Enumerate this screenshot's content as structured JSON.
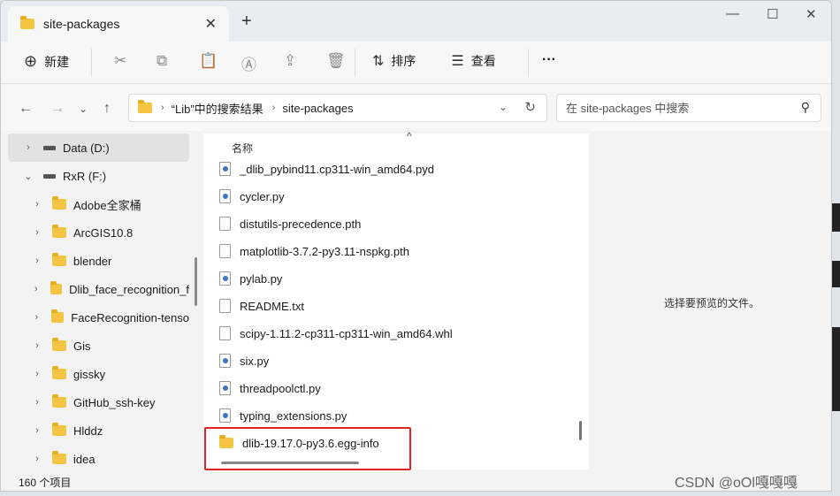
{
  "window": {
    "tab_title": "site-packages"
  },
  "toolbar": {
    "new_label": "新建",
    "sort_label": "排序",
    "view_label": "查看"
  },
  "address": {
    "crumbs": [
      "“Lib”中的搜索结果",
      "site-packages"
    ],
    "search_placeholder": "在 site-packages 中搜索"
  },
  "sidebar": {
    "items": [
      {
        "label": "Data (D:)",
        "type": "drive",
        "expanded": false,
        "selected": true
      },
      {
        "label": "RxR (F:)",
        "type": "drive",
        "expanded": true,
        "selected": false
      },
      {
        "label": "Adobe全家桶",
        "type": "folder"
      },
      {
        "label": "ArcGIS10.8",
        "type": "folder"
      },
      {
        "label": "blender",
        "type": "folder"
      },
      {
        "label": "Dlib_face_recognition_f",
        "type": "folder"
      },
      {
        "label": "FaceRecognition-tenso",
        "type": "folder"
      },
      {
        "label": "Gis",
        "type": "folder"
      },
      {
        "label": "gissky",
        "type": "folder"
      },
      {
        "label": "GitHub_ssh-key",
        "type": "folder"
      },
      {
        "label": "Hlddz",
        "type": "folder"
      },
      {
        "label": "idea",
        "type": "folder"
      }
    ]
  },
  "files": {
    "column_header": "名称",
    "items": [
      {
        "name": "_dlib_pybind11.cp311-win_amd64.pyd",
        "icon": "py-file-icon"
      },
      {
        "name": "cycler.py",
        "icon": "py-file-icon"
      },
      {
        "name": "distutils-precedence.pth",
        "icon": "file-icon"
      },
      {
        "name": "matplotlib-3.7.2-py3.11-nspkg.pth",
        "icon": "file-icon"
      },
      {
        "name": "pylab.py",
        "icon": "py-file-icon"
      },
      {
        "name": "README.txt",
        "icon": "file-icon"
      },
      {
        "name": "scipy-1.11.2-cp311-cp311-win_amd64.whl",
        "icon": "file-icon"
      },
      {
        "name": "six.py",
        "icon": "py-file-icon"
      },
      {
        "name": "threadpoolctl.py",
        "icon": "py-file-icon"
      },
      {
        "name": "typing_extensions.py",
        "icon": "py-file-icon"
      },
      {
        "name": "dlib-19.17.0-py3.6.egg-info",
        "icon": "folder-icon"
      }
    ]
  },
  "preview": {
    "empty_text": "选择要预览的文件。"
  },
  "status": {
    "count_text": "160 个项目"
  },
  "watermark": {
    "text": "CSDN @oOl嘎嘎嘎"
  },
  "colors": {
    "highlight": "#e02424",
    "folder": "#f6c443",
    "python": "#3b78c4"
  }
}
